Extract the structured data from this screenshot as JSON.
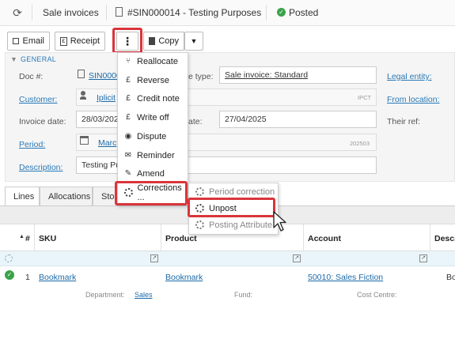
{
  "header": {
    "breadcrumb": "Sale invoices",
    "doc_title": "#SIN000014 - Testing Purposes",
    "status": "Posted"
  },
  "toolbar": {
    "email": "Email",
    "receipt": "Receipt",
    "copy": "Copy"
  },
  "section": {
    "general": "GENERAL"
  },
  "form": {
    "doc_no_label": "Doc #:",
    "doc_no_value": "SIN0000",
    "type_label": "e type:",
    "type_value": "Sale invoice: Standard",
    "legal_entity_label": "Legal entity:",
    "customer_label": "Customer:",
    "customer_value": "Iplicit",
    "customer_code": "IPCT",
    "from_location_label": "From location:",
    "invoice_date_label": "Invoice date:",
    "invoice_date_value": "28/03/202",
    "due_date_label": "ate:",
    "due_date_value": "27/04/2025",
    "their_ref_label": "Their ref:",
    "period_label": "Period:",
    "period_value": "Marc",
    "period_code": "202503",
    "description_label": "Description:",
    "description_value": "Testing Pu"
  },
  "tabs": [
    "Lines",
    "Allocations",
    "Stoc"
  ],
  "menu": {
    "items": [
      "Reallocate",
      "Reverse",
      "Credit note",
      "Write off",
      "Dispute",
      "Reminder",
      "Amend",
      "Corrections ..."
    ]
  },
  "submenu": {
    "items": [
      "Period correction",
      "Unpost",
      "Posting Attribute"
    ]
  },
  "table": {
    "headers": {
      "num": "#",
      "sku": "SKU",
      "product": "Product",
      "account": "Account",
      "desc": "Descri"
    },
    "row": {
      "num": "1",
      "sku": "Bookmark",
      "product": "Bookmark",
      "account": "50010: Sales Fiction",
      "desc": "Book"
    },
    "sub": {
      "department_label": "Department:",
      "department_value": "Sales",
      "fund_label": "Fund:",
      "cost_centre_label": "Cost Centre:"
    }
  }
}
